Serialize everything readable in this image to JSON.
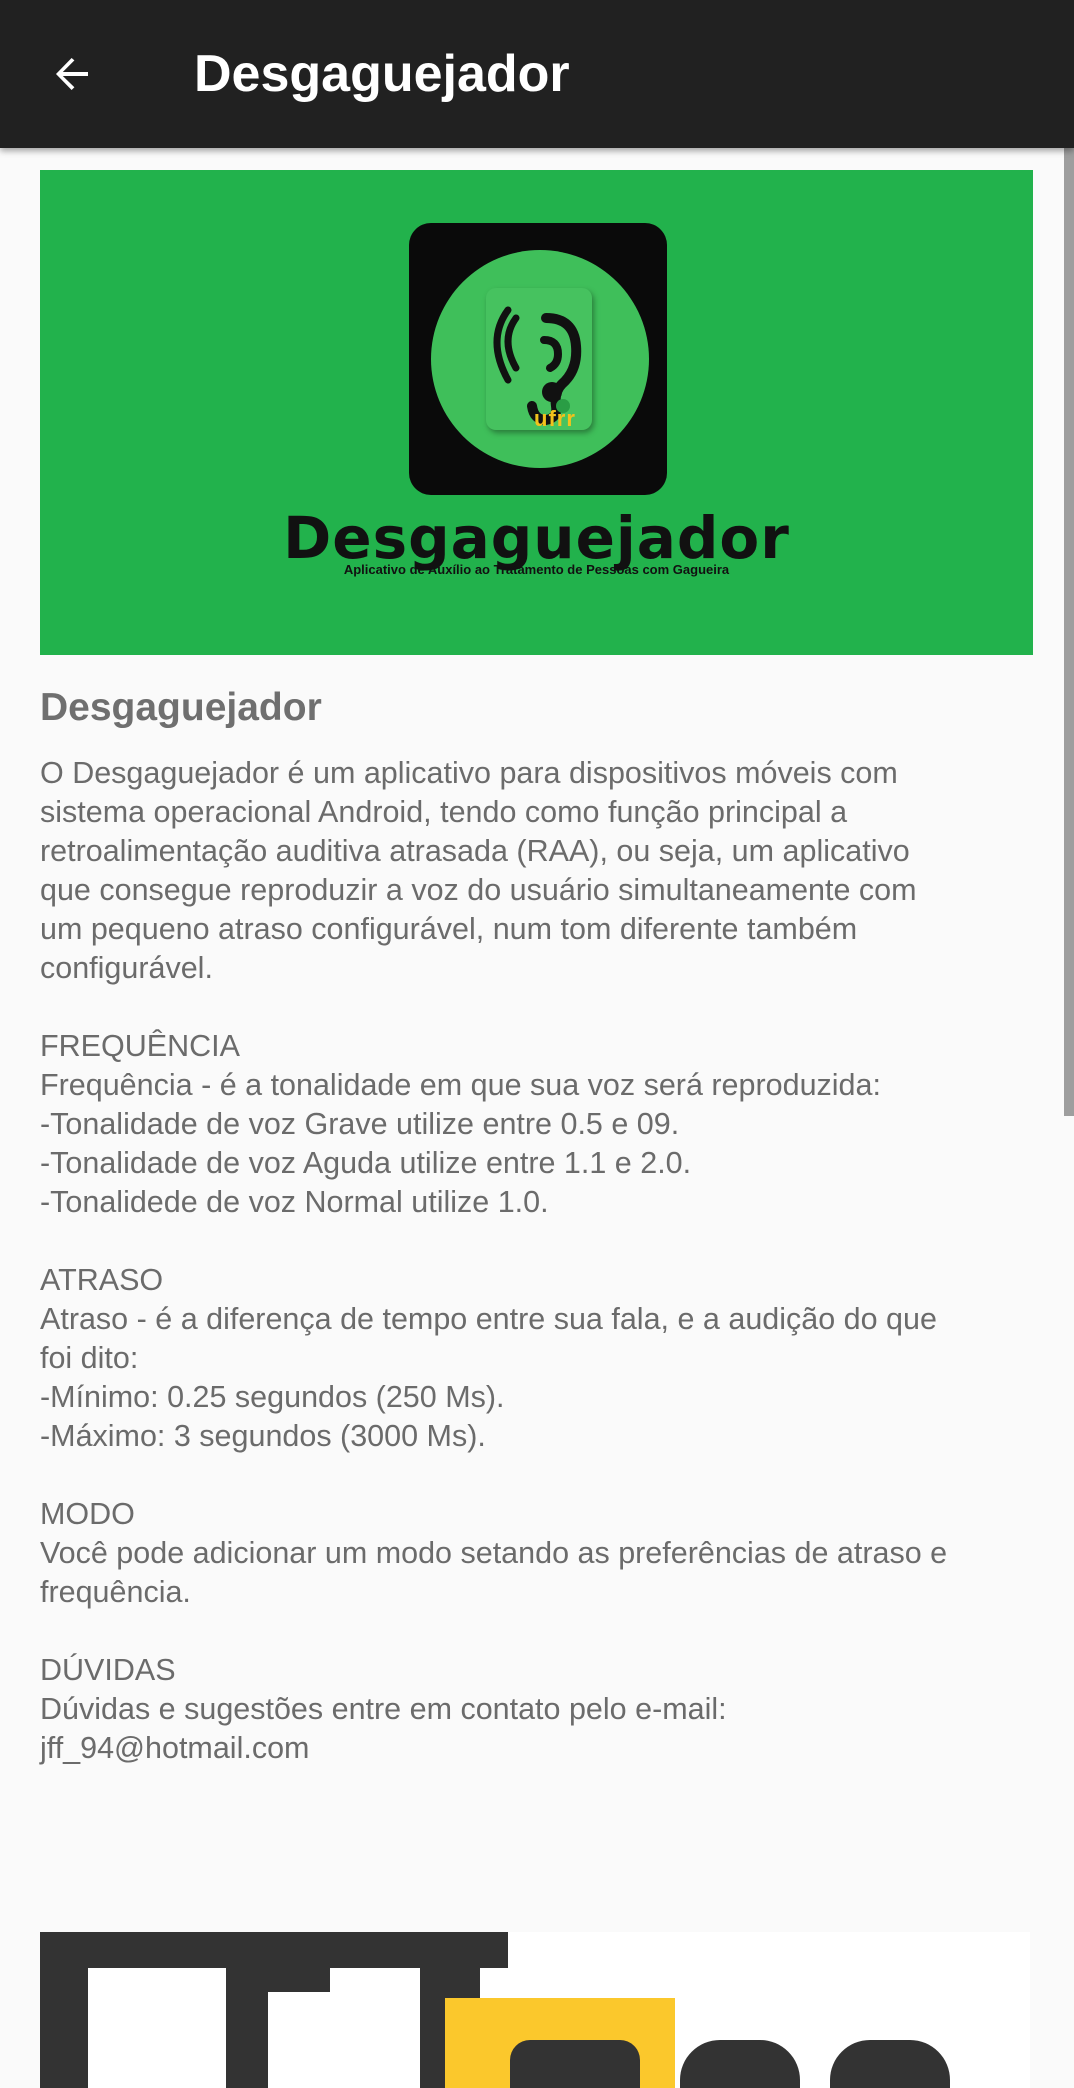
{
  "appbar": {
    "title": "Desgaguejador",
    "back_icon": "arrow-back-icon"
  },
  "banner": {
    "icon": "ear-sound-icon",
    "logo_small": "ufrr",
    "title": "Desgaguejador",
    "subtitle": "Aplicativo de Auxílio ao Tratamento de Pessoas com Gagueira",
    "background_color": "#22b24c"
  },
  "content": {
    "title": "Desgaguejador",
    "intro": [
      "O Desgaguejador é um aplicativo para dispositivos móveis com",
      "sistema operacional Android, tendo como função principal a",
      "retroalimentação auditiva atrasada (RAA), ou seja, um aplicativo",
      "que consegue reproduzir a voz do usuário simultaneamente com",
      "um pequeno atraso configurável, num tom diferente também",
      "configurável."
    ],
    "frequencia": [
      "FREQUÊNCIA",
      "Frequência - é a tonalidade em que sua voz será reproduzida:",
      "-Tonalidade de voz Grave utilize entre 0.5 e 09.",
      "-Tonalidade de voz Aguda utilize entre 1.1 e 2.0.",
      "-Tonalidede de voz Normal utilize 1.0."
    ],
    "atraso": [
      "ATRASO",
      "Atraso - é a diferença de tempo entre sua fala, e a audição do que",
      "foi dito:",
      "-Mínimo: 0.25 segundos (250 Ms).",
      "-Máximo: 3 segundos (3000 Ms)."
    ],
    "modo": [
      "MODO",
      "Você pode adicionar um modo setando as preferências de atraso e",
      "frequência."
    ],
    "duvidas": [
      "DÚVIDAS",
      "Dúvidas e sugestões entre em contato pelo e-mail:",
      "jff_94@hotmail.com"
    ]
  },
  "footer": {
    "logo": "ufrr-logo"
  },
  "colors": {
    "appbar": "#212121",
    "background": "#fafafa",
    "text": "#6b6b6b",
    "accent_green": "#22b24c",
    "logo_yellow": "#fbc82c"
  }
}
